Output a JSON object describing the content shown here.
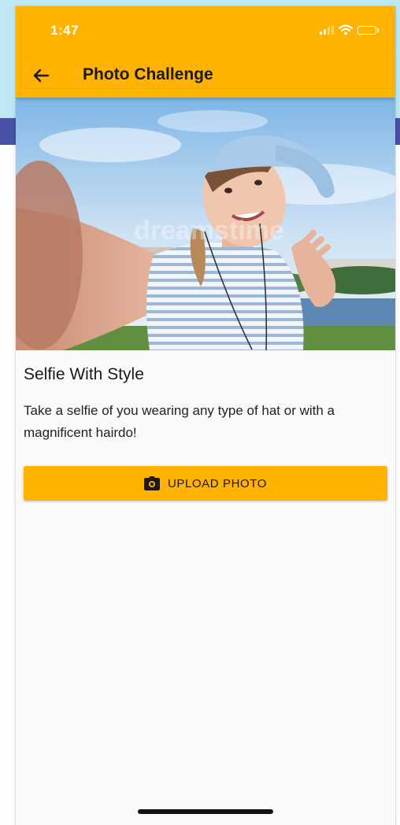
{
  "status_bar": {
    "time": "1:47"
  },
  "app_bar": {
    "title": "Photo Challenge",
    "back_icon": "arrow-left-icon"
  },
  "hero_image": {
    "watermark": "dreamstime"
  },
  "challenge": {
    "title": "Selfie With Style",
    "description": "Take a selfie of you wearing any type of hat or with a magnificent hairdo!"
  },
  "upload_button": {
    "label": "UPLOAD PHOTO",
    "icon": "camera-icon"
  },
  "colors": {
    "accent": "#ffb300",
    "background": "#fafafa",
    "backdrop_top": "#bde8f4",
    "backdrop_band": "#4a52a6"
  }
}
